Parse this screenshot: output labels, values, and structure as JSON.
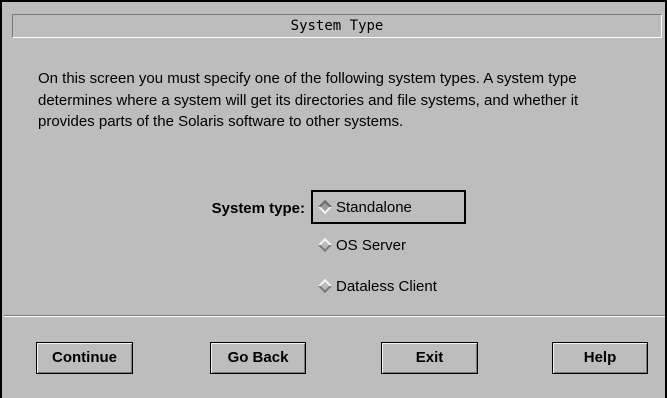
{
  "window": {
    "title": "System Type"
  },
  "description": "On this screen you must specify one of the following system types. A system type determines where a system will get its directories and file systems, and whether it provides parts of the Solaris software to other systems.",
  "system_type": {
    "label": "System type:",
    "options": [
      {
        "label": "Standalone",
        "selected": true,
        "focused": true
      },
      {
        "label": "OS Server",
        "selected": false,
        "focused": false
      },
      {
        "label": "Dataless Client",
        "selected": false,
        "focused": false
      }
    ]
  },
  "buttons": {
    "continue": "Continue",
    "go_back": "Go Back",
    "exit": "Exit",
    "help": "Help"
  },
  "colors": {
    "background": "#bdbdbd",
    "border": "#000000"
  },
  "icons": {
    "radio": "diamond-radio-icon"
  }
}
